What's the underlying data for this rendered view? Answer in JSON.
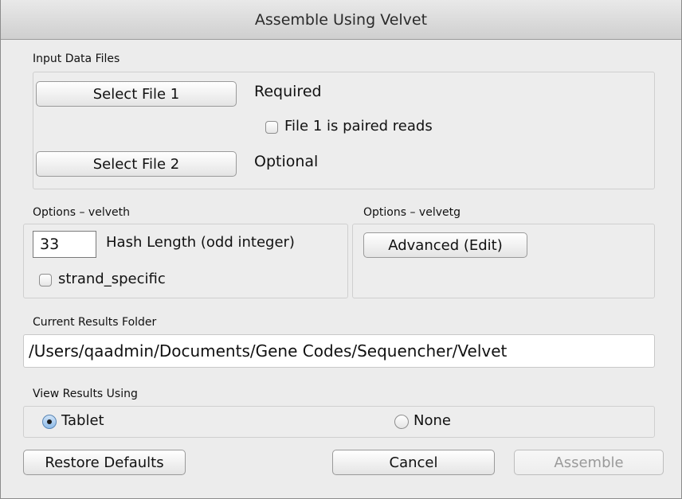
{
  "window": {
    "title": "Assemble Using Velvet"
  },
  "input_files": {
    "label": "Input Data Files",
    "file1_button": "Select File 1",
    "file1_status": "Required",
    "paired_checkbox_label": "File 1 is paired reads",
    "paired_checked": false,
    "file2_button": "Select File 2",
    "file2_status": "Optional"
  },
  "velveth": {
    "label": "Options – velveth",
    "hash_value": "33",
    "hash_label": "Hash Length (odd integer)",
    "strand_label": "strand_specific",
    "strand_checked": false
  },
  "velvetg": {
    "label": "Options – velvetg",
    "advanced_button": "Advanced (Edit)"
  },
  "results_folder": {
    "label": "Current Results Folder",
    "path": "/Users/qaadmin/Documents/Gene Codes/Sequencher/Velvet"
  },
  "view_results": {
    "label": "View Results Using",
    "option_tablet": "Tablet",
    "option_none": "None",
    "selected": "Tablet"
  },
  "footer": {
    "restore_button": "Restore Defaults",
    "cancel_button": "Cancel",
    "assemble_button": "Assemble"
  }
}
